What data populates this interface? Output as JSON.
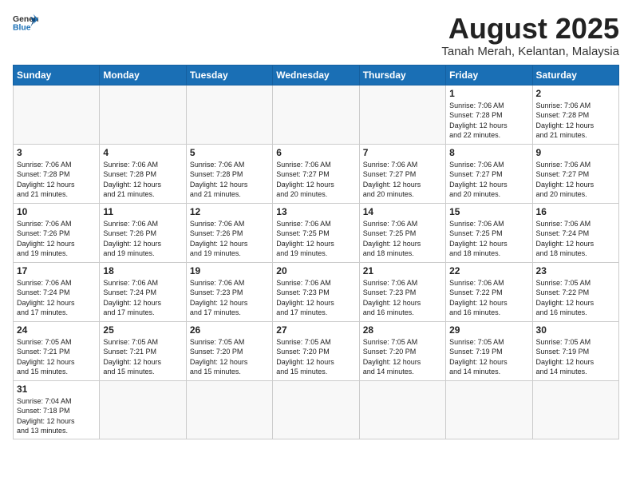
{
  "header": {
    "logo_general": "General",
    "logo_blue": "Blue",
    "month_title": "August 2025",
    "location": "Tanah Merah, Kelantan, Malaysia"
  },
  "weekdays": [
    "Sunday",
    "Monday",
    "Tuesday",
    "Wednesday",
    "Thursday",
    "Friday",
    "Saturday"
  ],
  "weeks": [
    [
      {
        "day": "",
        "info": ""
      },
      {
        "day": "",
        "info": ""
      },
      {
        "day": "",
        "info": ""
      },
      {
        "day": "",
        "info": ""
      },
      {
        "day": "",
        "info": ""
      },
      {
        "day": "1",
        "info": "Sunrise: 7:06 AM\nSunset: 7:28 PM\nDaylight: 12 hours\nand 22 minutes."
      },
      {
        "day": "2",
        "info": "Sunrise: 7:06 AM\nSunset: 7:28 PM\nDaylight: 12 hours\nand 21 minutes."
      }
    ],
    [
      {
        "day": "3",
        "info": "Sunrise: 7:06 AM\nSunset: 7:28 PM\nDaylight: 12 hours\nand 21 minutes."
      },
      {
        "day": "4",
        "info": "Sunrise: 7:06 AM\nSunset: 7:28 PM\nDaylight: 12 hours\nand 21 minutes."
      },
      {
        "day": "5",
        "info": "Sunrise: 7:06 AM\nSunset: 7:28 PM\nDaylight: 12 hours\nand 21 minutes."
      },
      {
        "day": "6",
        "info": "Sunrise: 7:06 AM\nSunset: 7:27 PM\nDaylight: 12 hours\nand 20 minutes."
      },
      {
        "day": "7",
        "info": "Sunrise: 7:06 AM\nSunset: 7:27 PM\nDaylight: 12 hours\nand 20 minutes."
      },
      {
        "day": "8",
        "info": "Sunrise: 7:06 AM\nSunset: 7:27 PM\nDaylight: 12 hours\nand 20 minutes."
      },
      {
        "day": "9",
        "info": "Sunrise: 7:06 AM\nSunset: 7:27 PM\nDaylight: 12 hours\nand 20 minutes."
      }
    ],
    [
      {
        "day": "10",
        "info": "Sunrise: 7:06 AM\nSunset: 7:26 PM\nDaylight: 12 hours\nand 19 minutes."
      },
      {
        "day": "11",
        "info": "Sunrise: 7:06 AM\nSunset: 7:26 PM\nDaylight: 12 hours\nand 19 minutes."
      },
      {
        "day": "12",
        "info": "Sunrise: 7:06 AM\nSunset: 7:26 PM\nDaylight: 12 hours\nand 19 minutes."
      },
      {
        "day": "13",
        "info": "Sunrise: 7:06 AM\nSunset: 7:25 PM\nDaylight: 12 hours\nand 19 minutes."
      },
      {
        "day": "14",
        "info": "Sunrise: 7:06 AM\nSunset: 7:25 PM\nDaylight: 12 hours\nand 18 minutes."
      },
      {
        "day": "15",
        "info": "Sunrise: 7:06 AM\nSunset: 7:25 PM\nDaylight: 12 hours\nand 18 minutes."
      },
      {
        "day": "16",
        "info": "Sunrise: 7:06 AM\nSunset: 7:24 PM\nDaylight: 12 hours\nand 18 minutes."
      }
    ],
    [
      {
        "day": "17",
        "info": "Sunrise: 7:06 AM\nSunset: 7:24 PM\nDaylight: 12 hours\nand 17 minutes."
      },
      {
        "day": "18",
        "info": "Sunrise: 7:06 AM\nSunset: 7:24 PM\nDaylight: 12 hours\nand 17 minutes."
      },
      {
        "day": "19",
        "info": "Sunrise: 7:06 AM\nSunset: 7:23 PM\nDaylight: 12 hours\nand 17 minutes."
      },
      {
        "day": "20",
        "info": "Sunrise: 7:06 AM\nSunset: 7:23 PM\nDaylight: 12 hours\nand 17 minutes."
      },
      {
        "day": "21",
        "info": "Sunrise: 7:06 AM\nSunset: 7:23 PM\nDaylight: 12 hours\nand 16 minutes."
      },
      {
        "day": "22",
        "info": "Sunrise: 7:06 AM\nSunset: 7:22 PM\nDaylight: 12 hours\nand 16 minutes."
      },
      {
        "day": "23",
        "info": "Sunrise: 7:05 AM\nSunset: 7:22 PM\nDaylight: 12 hours\nand 16 minutes."
      }
    ],
    [
      {
        "day": "24",
        "info": "Sunrise: 7:05 AM\nSunset: 7:21 PM\nDaylight: 12 hours\nand 15 minutes."
      },
      {
        "day": "25",
        "info": "Sunrise: 7:05 AM\nSunset: 7:21 PM\nDaylight: 12 hours\nand 15 minutes."
      },
      {
        "day": "26",
        "info": "Sunrise: 7:05 AM\nSunset: 7:20 PM\nDaylight: 12 hours\nand 15 minutes."
      },
      {
        "day": "27",
        "info": "Sunrise: 7:05 AM\nSunset: 7:20 PM\nDaylight: 12 hours\nand 15 minutes."
      },
      {
        "day": "28",
        "info": "Sunrise: 7:05 AM\nSunset: 7:20 PM\nDaylight: 12 hours\nand 14 minutes."
      },
      {
        "day": "29",
        "info": "Sunrise: 7:05 AM\nSunset: 7:19 PM\nDaylight: 12 hours\nand 14 minutes."
      },
      {
        "day": "30",
        "info": "Sunrise: 7:05 AM\nSunset: 7:19 PM\nDaylight: 12 hours\nand 14 minutes."
      }
    ],
    [
      {
        "day": "31",
        "info": "Sunrise: 7:04 AM\nSunset: 7:18 PM\nDaylight: 12 hours\nand 13 minutes."
      },
      {
        "day": "",
        "info": ""
      },
      {
        "day": "",
        "info": ""
      },
      {
        "day": "",
        "info": ""
      },
      {
        "day": "",
        "info": ""
      },
      {
        "day": "",
        "info": ""
      },
      {
        "day": "",
        "info": ""
      }
    ]
  ]
}
